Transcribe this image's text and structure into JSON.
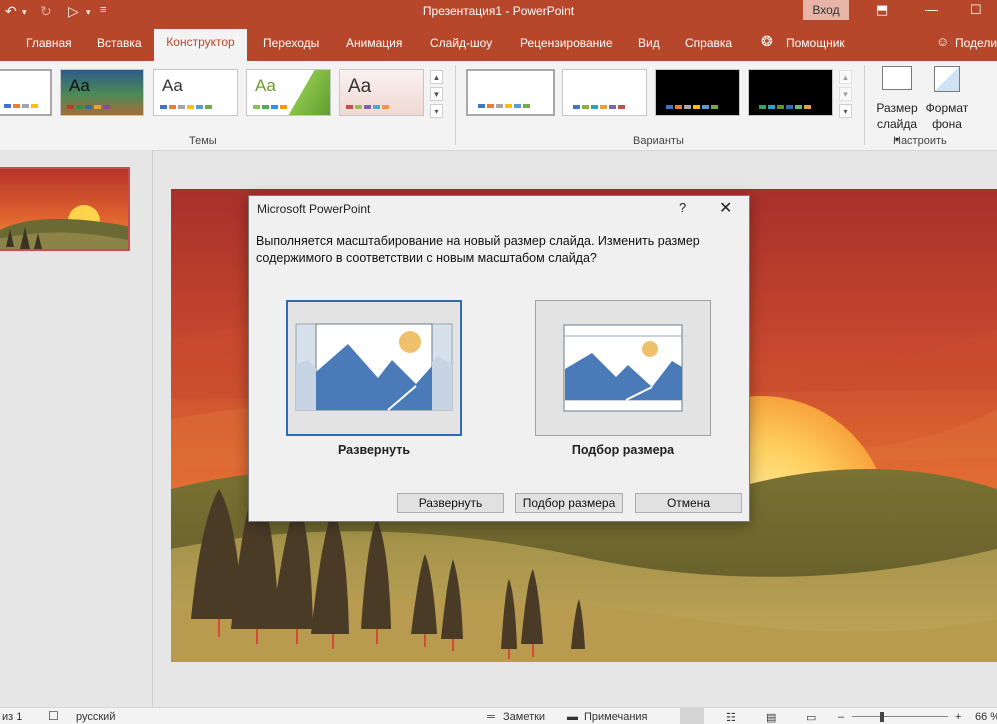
{
  "titlebar": {
    "title": "Презентация1  -  PowerPoint",
    "sign_in": "Вход",
    "undo_icon": "undo-icon",
    "redo_icon": "redo-icon",
    "present_icon": "slideshow-icon"
  },
  "tabs": [
    {
      "label": "Главная"
    },
    {
      "label": "Вставка"
    },
    {
      "label": "Конструктор"
    },
    {
      "label": "Переходы"
    },
    {
      "label": "Анимация"
    },
    {
      "label": "Слайд-шоу"
    },
    {
      "label": "Рецензирование"
    },
    {
      "label": "Вид"
    },
    {
      "label": "Справка"
    },
    {
      "label": "Помощник"
    },
    {
      "label": "Подели"
    }
  ],
  "ribbon": {
    "themes_label": "Темы",
    "variants_label": "Варианты",
    "customize_label": "Настроить",
    "theme_aa": "Aa",
    "slide_size": {
      "line1": "Размер",
      "line2": "слайда"
    },
    "format_bg": {
      "line1": "Формат",
      "line2": "фона"
    }
  },
  "dialog": {
    "title": "Microsoft PowerPoint",
    "help": "?",
    "message": "Выполняется масштабирование на новый размер слайда. Изменить размер содержимого в соответствии с новым масштабом слайда?",
    "option_maximize": "Развернуть",
    "option_fit": "Подбор размера",
    "btn_maximize": "Развернуть",
    "btn_fit": "Подбор размера",
    "btn_cancel": "Отмена"
  },
  "status": {
    "slide_count": "из 1",
    "language": "русский",
    "notes": "Заметки",
    "comments": "Примечания",
    "zoom": "66 %"
  },
  "colors": {
    "accent": "#b7472a",
    "dialog_bg": "#f0f0f0",
    "selected_border": "#2e6db4"
  }
}
